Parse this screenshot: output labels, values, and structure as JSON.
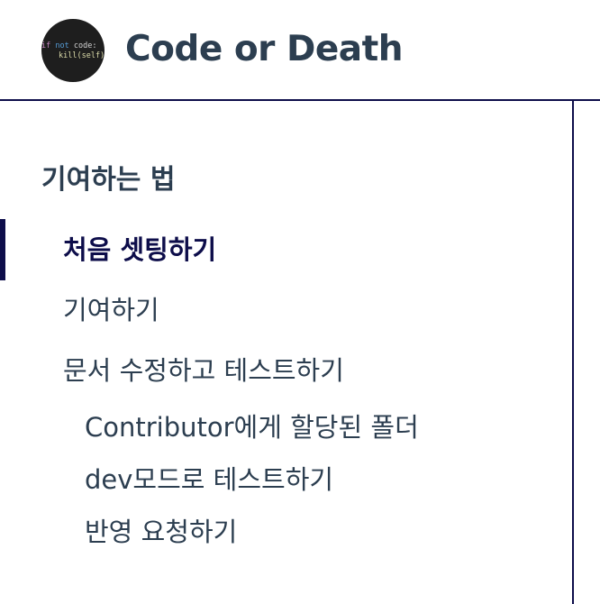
{
  "header": {
    "logo_code_line1_kw": "if",
    "logo_code_line1_kw2": "not",
    "logo_code_line1_rest": "code:",
    "logo_code_line2": "kill(self)",
    "title": "Code or Death"
  },
  "sidebar": {
    "heading": "기여하는 법",
    "items": [
      {
        "label": "처음 셋팅하기",
        "active": true
      },
      {
        "label": "기여하기",
        "active": false
      },
      {
        "label": "문서 수정하고 테스트하기",
        "active": false
      }
    ],
    "subitems": [
      {
        "label": "Contributor에게 할당된 폴더"
      },
      {
        "label": "dev모드로 테스트하기"
      },
      {
        "label": "반영 요청하기"
      }
    ]
  },
  "colors": {
    "accent": "#0d0d4a",
    "text": "#2c3e50",
    "logo_bg": "#1e1e1e"
  }
}
